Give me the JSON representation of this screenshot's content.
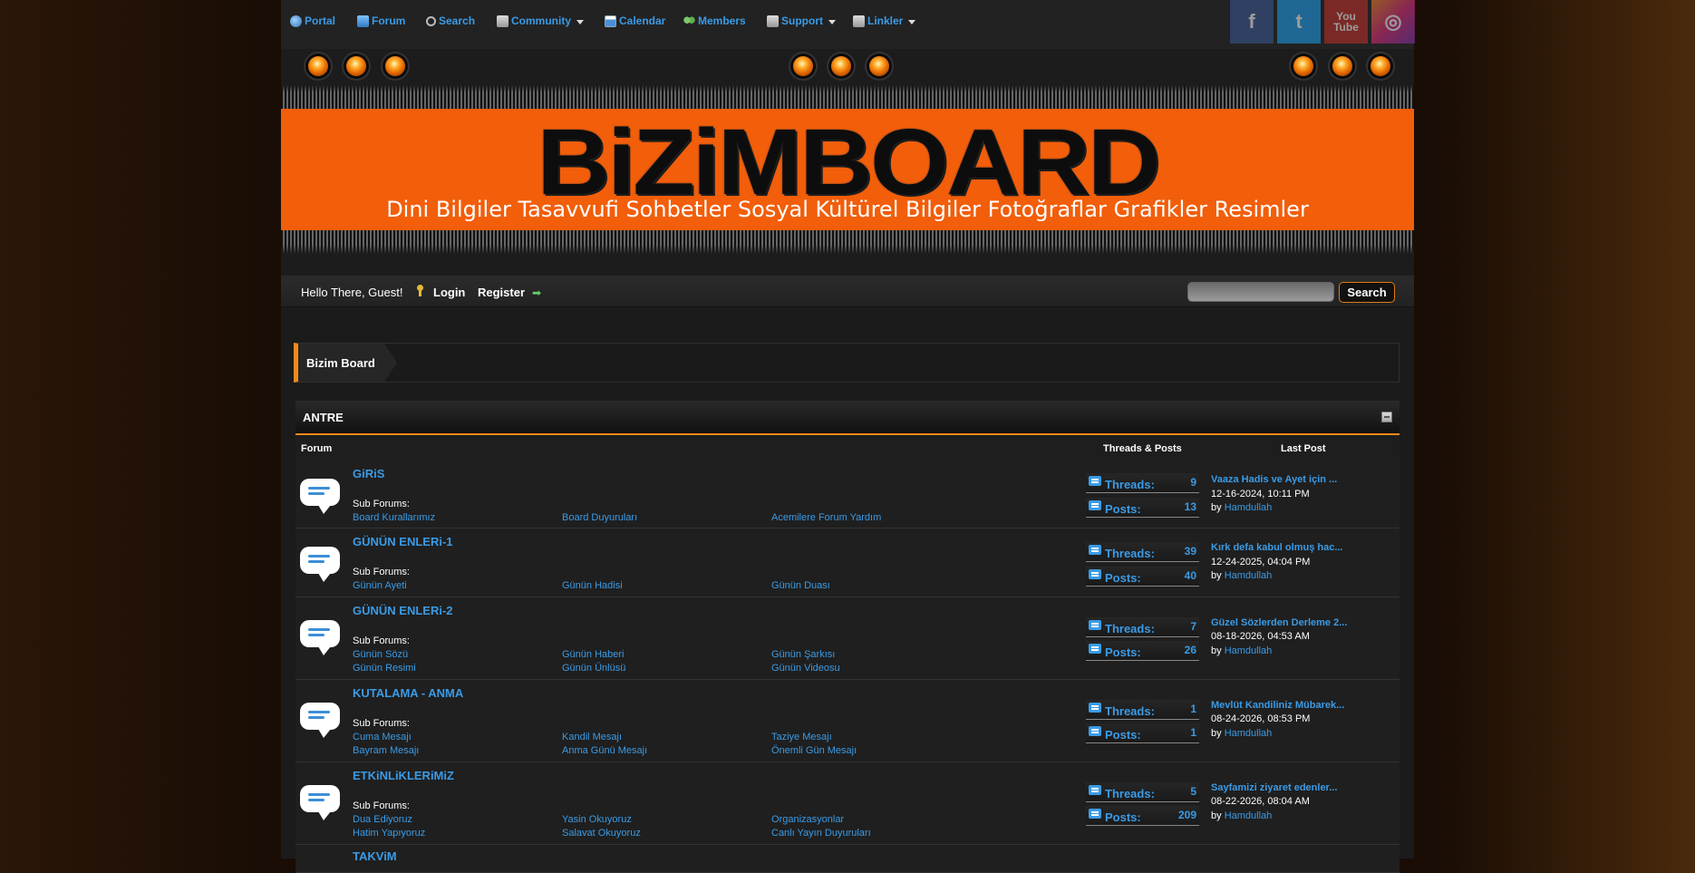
{
  "nav": {
    "items": [
      {
        "label": "Portal",
        "icon": "globe-icon"
      },
      {
        "label": "Forum",
        "icon": "forum-icon"
      },
      {
        "label": "Search",
        "icon": "search-icon"
      },
      {
        "label": "Community",
        "icon": "community-icon"
      },
      {
        "label": "Calendar",
        "icon": "calendar-icon"
      },
      {
        "label": "Members",
        "icon": "members-icon"
      },
      {
        "label": "Support",
        "icon": "support-icon"
      },
      {
        "label": "Linkler",
        "icon": "links-icon"
      }
    ],
    "social": [
      {
        "name": "facebook-icon",
        "glyph": "f",
        "color": "#3b5998"
      },
      {
        "name": "twitter-icon",
        "glyph": "t",
        "color": "#1da1f2"
      },
      {
        "name": "youtube-icon",
        "glyph": "You Tube",
        "color": "#c4302b"
      },
      {
        "name": "instagram-icon",
        "glyph": "◎",
        "color": "#8a3ab9"
      }
    ]
  },
  "banner": {
    "logo": "BiZiMBOARD",
    "tagline": "Dini Bilgiler Tasavvufi Sohbetler Sosyal Kültürel Bilgiler Fotoğraflar Grafikler Resimler",
    "accent": "#f25e0a"
  },
  "userbar": {
    "greeting": "Hello There, Guest!",
    "login": "Login",
    "register": "Register",
    "search_button": "Search",
    "search_value": ""
  },
  "breadcrumb": {
    "item": "Bizim Board"
  },
  "category": {
    "title": "ANTRE",
    "col_forum": "Forum",
    "col_stats": "Threads & Posts",
    "col_lastpost": "Last Post",
    "threads_label": "Threads:",
    "posts_label": "Posts:",
    "subforums_label": "Sub Forums:",
    "by_label": "by",
    "forums": [
      {
        "name": "GiRiS",
        "subs": [
          "Board Kurallarımız",
          "Board Duyuruları",
          "Acemilere Forum Yardım"
        ],
        "threads": "9",
        "posts": "13",
        "last_title": "Vaaza Hadis ve Ayet için ...",
        "last_date": "12-16-2024, 10:11 PM",
        "last_user": "Hamdullah"
      },
      {
        "name": "GÜNÜN ENLERi-1",
        "subs": [
          "Günün Ayeti",
          "Günün Hadisi",
          "Günün Duası"
        ],
        "threads": "39",
        "posts": "40",
        "last_title": "Kırk defa kabul olmuş hac...",
        "last_date": "12-24-2025, 04:04 PM",
        "last_user": "Hamdullah"
      },
      {
        "name": "GÜNÜN ENLERi-2",
        "subs": [
          "Günün Sözü",
          "Günün Haberi",
          "Günün Şarkısı",
          "Günün Resimi",
          "Günün Ünlüsü",
          "Günün Videosu"
        ],
        "threads": "7",
        "posts": "26",
        "last_title": "Güzel Sözlerden Derleme 2...",
        "last_date": "08-18-2026, 04:53 AM",
        "last_user": "Hamdullah"
      },
      {
        "name": "KUTALAMA - ANMA",
        "subs": [
          "Cuma Mesajı",
          "Kandil Mesajı",
          "Taziye Mesajı",
          "Bayram Mesajı",
          "Anma Günü Mesajı",
          "Önemli Gün Mesajı"
        ],
        "threads": "1",
        "posts": "1",
        "last_title": "Mevlüt Kandiliniz Mübarek...",
        "last_date": "08-24-2026, 08:53 PM",
        "last_user": "Hamdullah"
      },
      {
        "name": "ETKiNLiKLERiMiZ",
        "subs": [
          "Dua Ediyoruz",
          "Yasin Okuyoruz",
          "Organizasyonlar",
          "Hatim Yapıyoruz",
          "Salavat Okuyoruz",
          "Canlı Yayın Duyuruları"
        ],
        "threads": "5",
        "posts": "209",
        "last_title": "Sayfamizi ziyaret edenler...",
        "last_date": "08-22-2026, 08:04 AM",
        "last_user": "Hamdullah"
      },
      {
        "name": "TAKViM",
        "subs": [],
        "threads": "",
        "posts": "",
        "last_title": "",
        "last_date": "",
        "last_user": ""
      }
    ]
  }
}
